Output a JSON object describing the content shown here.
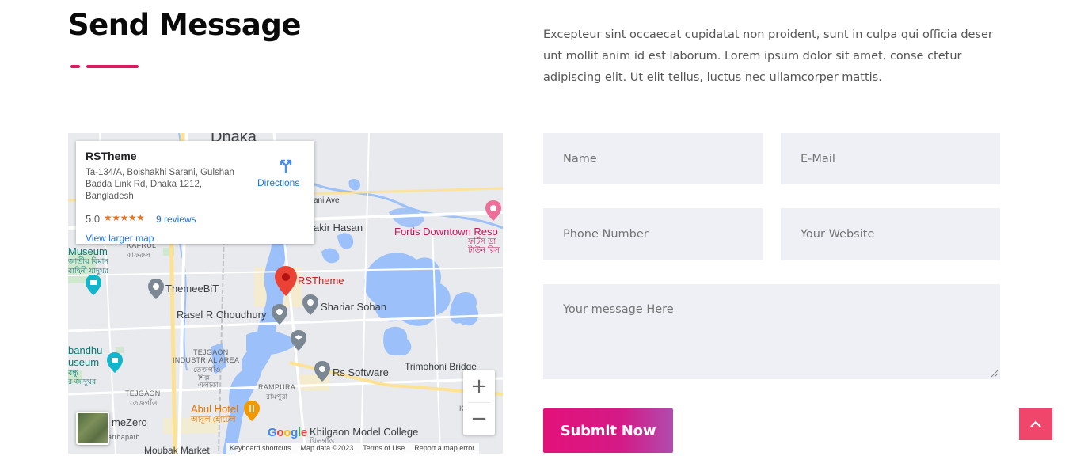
{
  "section": {
    "title": "Send Message",
    "intro": "Excepteur sint occaecat cupidatat non proident, sunt in culpa qui officia deser unt mollit anim id est laborum. Lorem ipsum dolor sit amet, conse ctetur adipiscing elit. Ut elit tellus, luctus nec ullamcorper mattis."
  },
  "map": {
    "card": {
      "name": "RSTheme",
      "address": "Ta-134/A, Boishakhi Sarani, Gulshan Badda Link Rd, Dhaka 1212, Bangladesh",
      "rating": "5.0",
      "stars": "★★★★★",
      "reviews": "9 reviews",
      "larger_map": "View larger map",
      "directions": "Directions"
    },
    "labels": {
      "dhaka": "Dhaka",
      "ani_ave": "ani Ave",
      "akir_hasan": "akir Hasan",
      "fortis": "Fortis Downtown Reso",
      "fortis_bn": "ফর্টিস ডা",
      "fortis_bn2": "টাউন রিস",
      "museum": "Museum",
      "museum_bn": "জাতীয় বিমান",
      "museum_bn2": "বাহিনী যাদুঘর",
      "kafrul": "KAFRUL",
      "kafrul_bn": "কাফরুল",
      "themeebit": "ThemeeBiT",
      "rstheme": "RSTheme",
      "shariar": "Shariar Sohan",
      "rasel": "Rasel R Choudhury",
      "tejgaon_ind": "TEJGAON",
      "tejgaon_ind2": "INDUSTRIAL AREA",
      "tejgaon_ind_bn": "তেজগাঁও",
      "tejgaon_ind_bn2": "শিল্প",
      "tejgaon_ind_bn3": "এলাকা",
      "bandhu": "bandhu",
      "bandhu2": "useum",
      "bandhu_bn": "বন্ধু",
      "bandhu_bn2": "র জাদুঘর",
      "rs_software": "Rs Software",
      "trimohoni": "Trimohoni Bridge",
      "rampura": "RAMPURA",
      "rampura_bn": "রামপুরা",
      "tejgaon": "TEJGAON",
      "tejgaon_bn": "তেজগাঁও",
      "abul_hotel": "Abul Hotel",
      "abul_hotel_bn": "আবুল হোটেল",
      "mezero": "meZero",
      "arthapath": "arthapath",
      "khilgaon": "Khilgaon Model College",
      "khilgaon_bn": "খিলগাঁও",
      "moghbazar": "Moubak Market",
      "ka": "K",
      "kaz": "Ka"
    },
    "zoom_in": "+",
    "zoom_out": "−",
    "google": [
      "G",
      "o",
      "o",
      "g",
      "l",
      "e"
    ],
    "attribution": [
      "Keyboard shortcuts",
      "Map data ©2023",
      "Terms of Use",
      "Report a map error"
    ]
  },
  "form": {
    "name_placeholder": "Name",
    "email_placeholder": "E-Mail",
    "phone_placeholder": "Phone Number",
    "website_placeholder": "Your Website",
    "message_placeholder": "Your message Here",
    "submit_label": "Submit Now"
  },
  "colors": {
    "accent": "#e0185f",
    "field_bg": "#eff0f6",
    "back_to_top": "#f0466c"
  },
  "icons": {
    "back_to_top": "chevron-up-icon",
    "directions": "directions-icon",
    "pin": "map-pin-icon"
  }
}
